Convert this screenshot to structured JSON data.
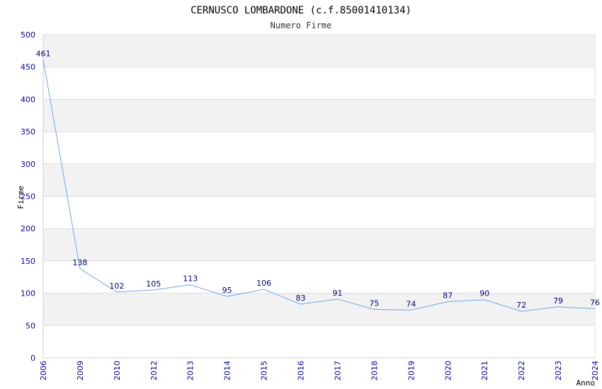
{
  "chart_data": {
    "type": "line",
    "title": "CERNUSCO LOMBARDONE (c.f.85001410134)",
    "subtitle": "Numero Firme",
    "xlabel": "Anno",
    "ylabel": "Firme",
    "ylim": [
      0,
      500
    ],
    "yticks": [
      "0",
      "50",
      "100",
      "150",
      "200",
      "250",
      "300",
      "350",
      "400",
      "450",
      "500"
    ],
    "categories": [
      "2006",
      "2009",
      "2010",
      "2012",
      "2013",
      "2014",
      "2015",
      "2016",
      "2017",
      "2018",
      "2019",
      "2020",
      "2021",
      "2022",
      "2023",
      "2024"
    ],
    "values": [
      461,
      138,
      102,
      105,
      113,
      95,
      106,
      83,
      91,
      75,
      74,
      87,
      90,
      72,
      79,
      76
    ],
    "grid": true,
    "colors": {
      "line": "#6aa8e8",
      "band": "#f2f2f2",
      "gridline": "#dddddd",
      "tick_text": "#0000aa",
      "data_label": "#000080"
    }
  }
}
